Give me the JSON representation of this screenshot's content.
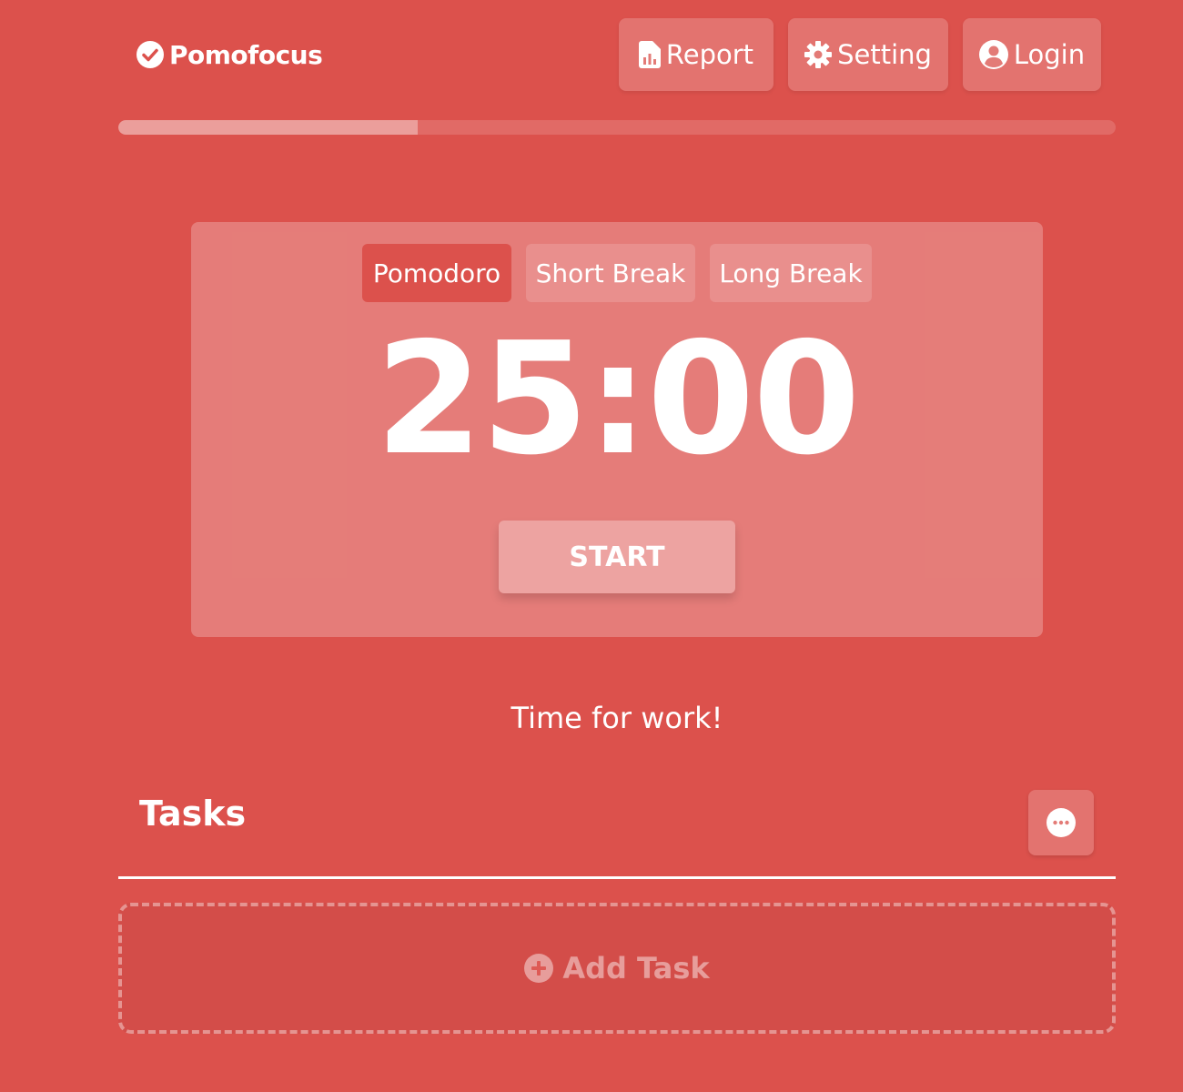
{
  "app": {
    "name": "Pomofocus",
    "logo_icon": "check-circle-icon"
  },
  "header": {
    "report_label": "Report",
    "report_icon": "report-icon",
    "setting_label": "Setting",
    "setting_icon": "gear-icon",
    "login_label": "Login",
    "login_icon": "user-circle-icon"
  },
  "progress": {
    "fraction": 0.3
  },
  "timer": {
    "modes": [
      {
        "label": "Pomodoro",
        "active": true
      },
      {
        "label": "Short Break",
        "active": false
      },
      {
        "label": "Long Break",
        "active": false
      }
    ],
    "time": "25:00",
    "start_label": "START"
  },
  "status_message": "Time for work!",
  "tasks": {
    "title": "Tasks",
    "menu_icon": "ellipsis-icon",
    "add_label": "Add Task",
    "add_icon": "plus-circle-icon"
  },
  "colors": {
    "background": "#dc514c",
    "active_mode": "#dc514c"
  }
}
